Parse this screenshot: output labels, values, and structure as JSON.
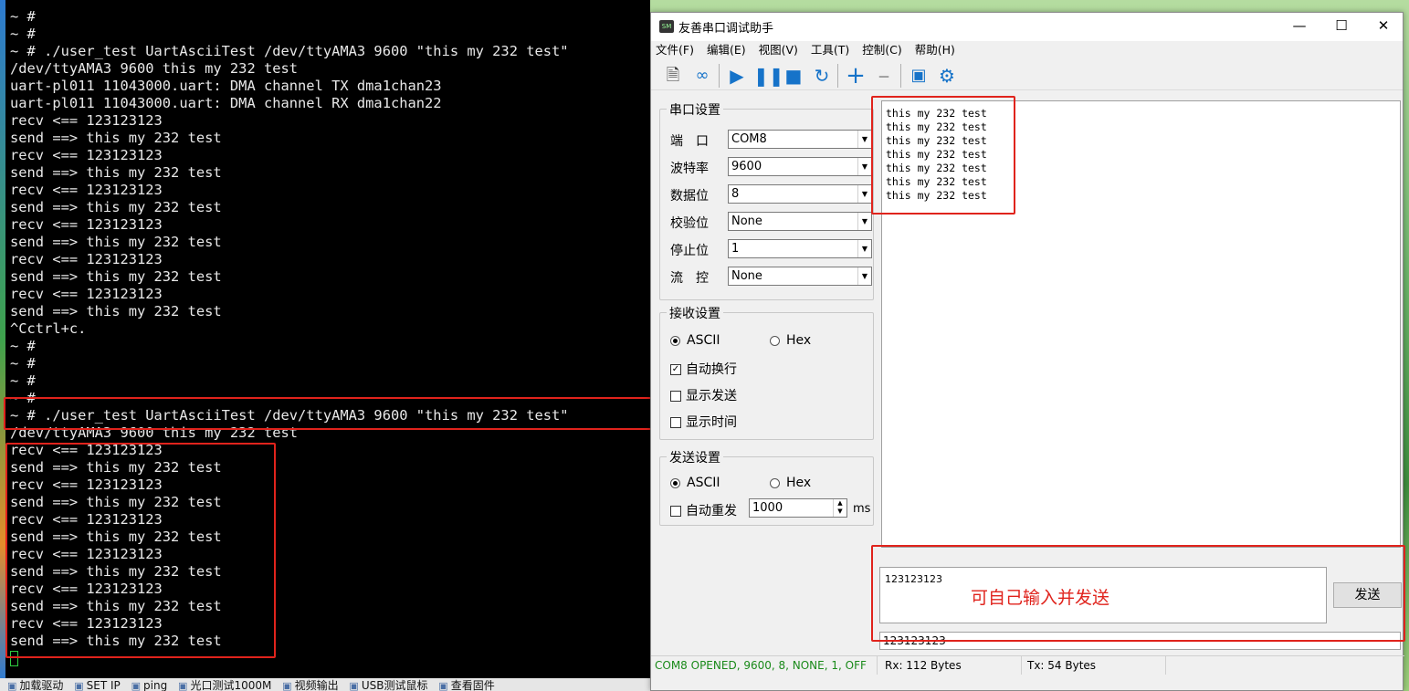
{
  "terminal": {
    "lines": [
      "~ #",
      "~ #",
      "~ # ./user_test UartAsciiTest /dev/ttyAMA3 9600 \"this my 232 test\"",
      "/dev/ttyAMA3 9600 this my 232 test",
      "uart-pl011 11043000.uart: DMA channel TX dma1chan23",
      "uart-pl011 11043000.uart: DMA channel RX dma1chan22",
      "recv <== 123123123",
      "send ==> this my 232 test",
      "recv <== 123123123",
      "send ==> this my 232 test",
      "recv <== 123123123",
      "send ==> this my 232 test",
      "recv <== 123123123",
      "send ==> this my 232 test",
      "recv <== 123123123",
      "send ==> this my 232 test",
      "recv <== 123123123",
      "send ==> this my 232 test",
      "^Cctrl+c.",
      "~ #",
      "~ #",
      "~ #",
      "~ #",
      "~ # ./user_test UartAsciiTest /dev/ttyAMA3 9600 \"this my 232 test\"",
      "/dev/ttyAMA3 9600 this my 232 test",
      "recv <== 123123123",
      "send ==> this my 232 test",
      "recv <== 123123123",
      "send ==> this my 232 test",
      "recv <== 123123123",
      "send ==> this my 232 test",
      "recv <== 123123123",
      "send ==> this my 232 test",
      "recv <== 123123123",
      "send ==> this my 232 test",
      "recv <== 123123123",
      "send ==> this my 232 test"
    ]
  },
  "taskbar": {
    "items": [
      "加载驱动",
      "SET IP",
      "ping",
      "光口测试1000M",
      "视频输出",
      "USB测试鼠标",
      "查看固件"
    ]
  },
  "window": {
    "title": "友善串口调试助手",
    "minimize": "—",
    "maximize": "☐",
    "close": "✕",
    "menus": [
      "文件(F)",
      "编辑(E)",
      "视图(V)",
      "工具(T)",
      "控制(C)",
      "帮助(H)"
    ]
  },
  "toolbar": {
    "icons": [
      "new-file-icon",
      "loop-icon",
      "play-icon",
      "pause-icon",
      "stop-icon",
      "refresh-icon",
      "plus-icon",
      "minus-icon",
      "window-icon",
      "gear-icon"
    ]
  },
  "serial_settings": {
    "title": "串口设置",
    "port_label": "端　口",
    "port_value": "COM8",
    "baud_label": "波特率",
    "baud_value": "9600",
    "data_label": "数据位",
    "data_value": "8",
    "parity_label": "校验位",
    "parity_value": "None",
    "stop_label": "停止位",
    "stop_value": "1",
    "flow_label": "流　控",
    "flow_value": "None"
  },
  "receive_settings": {
    "title": "接收设置",
    "ascii": "ASCII",
    "hex": "Hex",
    "auto_newline": "自动换行",
    "show_send": "显示发送",
    "show_time": "显示时间"
  },
  "send_settings": {
    "title": "发送设置",
    "ascii": "ASCII",
    "hex": "Hex",
    "auto_resend": "自动重发",
    "interval": "1000",
    "unit": "ms"
  },
  "receive_area": {
    "lines": [
      "this my 232 test",
      "this my 232 test",
      "this my 232 test",
      "this my 232 test",
      "this my 232 test",
      "this my 232 test",
      "this my 232 test"
    ]
  },
  "send_area": {
    "text": "123123123",
    "annotation": "可自己输入并发送",
    "send_button": "发送",
    "history_value": "123123123"
  },
  "status_bar": {
    "state": "COM8 OPENED, 9600, 8, NONE, 1, OFF",
    "rx": "Rx: 112 Bytes",
    "tx": "Tx: 54 Bytes"
  },
  "colors": {
    "highlight_box": "#e0231c",
    "status_ok": "#1a8a1a",
    "toolbar_icon": "#1673c9"
  }
}
